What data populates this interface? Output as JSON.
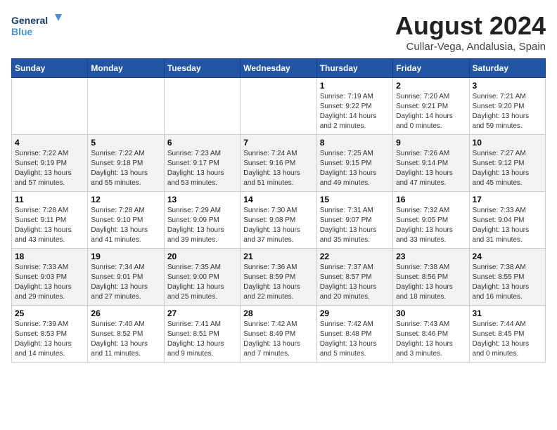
{
  "logo": {
    "line1": "General",
    "line2": "Blue"
  },
  "title": "August 2024",
  "subtitle": "Cullar-Vega, Andalusia, Spain",
  "weekdays": [
    "Sunday",
    "Monday",
    "Tuesday",
    "Wednesday",
    "Thursday",
    "Friday",
    "Saturday"
  ],
  "weeks": [
    [
      {
        "day": "",
        "info": ""
      },
      {
        "day": "",
        "info": ""
      },
      {
        "day": "",
        "info": ""
      },
      {
        "day": "",
        "info": ""
      },
      {
        "day": "1",
        "info": "Sunrise: 7:19 AM\nSunset: 9:22 PM\nDaylight: 14 hours\nand 2 minutes."
      },
      {
        "day": "2",
        "info": "Sunrise: 7:20 AM\nSunset: 9:21 PM\nDaylight: 14 hours\nand 0 minutes."
      },
      {
        "day": "3",
        "info": "Sunrise: 7:21 AM\nSunset: 9:20 PM\nDaylight: 13 hours\nand 59 minutes."
      }
    ],
    [
      {
        "day": "4",
        "info": "Sunrise: 7:22 AM\nSunset: 9:19 PM\nDaylight: 13 hours\nand 57 minutes."
      },
      {
        "day": "5",
        "info": "Sunrise: 7:22 AM\nSunset: 9:18 PM\nDaylight: 13 hours\nand 55 minutes."
      },
      {
        "day": "6",
        "info": "Sunrise: 7:23 AM\nSunset: 9:17 PM\nDaylight: 13 hours\nand 53 minutes."
      },
      {
        "day": "7",
        "info": "Sunrise: 7:24 AM\nSunset: 9:16 PM\nDaylight: 13 hours\nand 51 minutes."
      },
      {
        "day": "8",
        "info": "Sunrise: 7:25 AM\nSunset: 9:15 PM\nDaylight: 13 hours\nand 49 minutes."
      },
      {
        "day": "9",
        "info": "Sunrise: 7:26 AM\nSunset: 9:14 PM\nDaylight: 13 hours\nand 47 minutes."
      },
      {
        "day": "10",
        "info": "Sunrise: 7:27 AM\nSunset: 9:12 PM\nDaylight: 13 hours\nand 45 minutes."
      }
    ],
    [
      {
        "day": "11",
        "info": "Sunrise: 7:28 AM\nSunset: 9:11 PM\nDaylight: 13 hours\nand 43 minutes."
      },
      {
        "day": "12",
        "info": "Sunrise: 7:28 AM\nSunset: 9:10 PM\nDaylight: 13 hours\nand 41 minutes."
      },
      {
        "day": "13",
        "info": "Sunrise: 7:29 AM\nSunset: 9:09 PM\nDaylight: 13 hours\nand 39 minutes."
      },
      {
        "day": "14",
        "info": "Sunrise: 7:30 AM\nSunset: 9:08 PM\nDaylight: 13 hours\nand 37 minutes."
      },
      {
        "day": "15",
        "info": "Sunrise: 7:31 AM\nSunset: 9:07 PM\nDaylight: 13 hours\nand 35 minutes."
      },
      {
        "day": "16",
        "info": "Sunrise: 7:32 AM\nSunset: 9:05 PM\nDaylight: 13 hours\nand 33 minutes."
      },
      {
        "day": "17",
        "info": "Sunrise: 7:33 AM\nSunset: 9:04 PM\nDaylight: 13 hours\nand 31 minutes."
      }
    ],
    [
      {
        "day": "18",
        "info": "Sunrise: 7:33 AM\nSunset: 9:03 PM\nDaylight: 13 hours\nand 29 minutes."
      },
      {
        "day": "19",
        "info": "Sunrise: 7:34 AM\nSunset: 9:01 PM\nDaylight: 13 hours\nand 27 minutes."
      },
      {
        "day": "20",
        "info": "Sunrise: 7:35 AM\nSunset: 9:00 PM\nDaylight: 13 hours\nand 25 minutes."
      },
      {
        "day": "21",
        "info": "Sunrise: 7:36 AM\nSunset: 8:59 PM\nDaylight: 13 hours\nand 22 minutes."
      },
      {
        "day": "22",
        "info": "Sunrise: 7:37 AM\nSunset: 8:57 PM\nDaylight: 13 hours\nand 20 minutes."
      },
      {
        "day": "23",
        "info": "Sunrise: 7:38 AM\nSunset: 8:56 PM\nDaylight: 13 hours\nand 18 minutes."
      },
      {
        "day": "24",
        "info": "Sunrise: 7:38 AM\nSunset: 8:55 PM\nDaylight: 13 hours\nand 16 minutes."
      }
    ],
    [
      {
        "day": "25",
        "info": "Sunrise: 7:39 AM\nSunset: 8:53 PM\nDaylight: 13 hours\nand 14 minutes."
      },
      {
        "day": "26",
        "info": "Sunrise: 7:40 AM\nSunset: 8:52 PM\nDaylight: 13 hours\nand 11 minutes."
      },
      {
        "day": "27",
        "info": "Sunrise: 7:41 AM\nSunset: 8:51 PM\nDaylight: 13 hours\nand 9 minutes."
      },
      {
        "day": "28",
        "info": "Sunrise: 7:42 AM\nSunset: 8:49 PM\nDaylight: 13 hours\nand 7 minutes."
      },
      {
        "day": "29",
        "info": "Sunrise: 7:42 AM\nSunset: 8:48 PM\nDaylight: 13 hours\nand 5 minutes."
      },
      {
        "day": "30",
        "info": "Sunrise: 7:43 AM\nSunset: 8:46 PM\nDaylight: 13 hours\nand 3 minutes."
      },
      {
        "day": "31",
        "info": "Sunrise: 7:44 AM\nSunset: 8:45 PM\nDaylight: 13 hours\nand 0 minutes."
      }
    ]
  ]
}
